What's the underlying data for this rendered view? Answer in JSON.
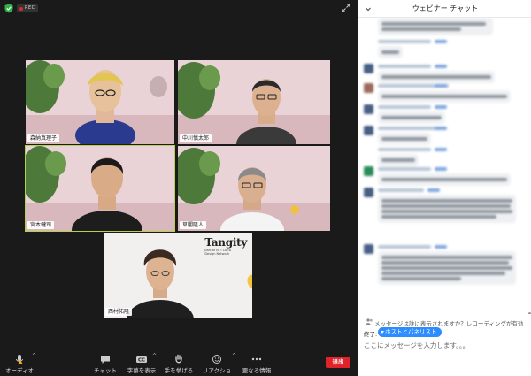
{
  "meeting": {
    "rec_label": "REC",
    "end_label": "退出"
  },
  "participants": [
    {
      "name": "森納真理子"
    },
    {
      "name": "中川慎太郎"
    },
    {
      "name": "宮本健司"
    },
    {
      "name": "草闇隆人"
    },
    {
      "name": "西村祐隆"
    }
  ],
  "shared_logo": {
    "brand": "Tangity",
    "sub1": "part of NTT DATA",
    "sub2": "Design Network"
  },
  "toolbar": {
    "audio_label": "オーディオ",
    "chat_label": "チャット",
    "captions_label": "字幕を表示",
    "raise_hand_label": "手を挙げる",
    "reactions_label": "リアクション",
    "more_label": "更なる情報",
    "cc_badge": "CC"
  },
  "chat": {
    "title": "ウェビナー チャット",
    "visibility_note": "メッセージは誰に表示されますか？レコーディングが有効",
    "to_label": "終了:",
    "recipient": "ホストとパネリスト",
    "input_placeholder": "ここにメッセージを入力します。。。"
  },
  "colors": {
    "accent": "#2d8cff",
    "end_red": "#e0232a",
    "active_speaker": "#b7cf4a",
    "rec_dot": "#e02828"
  }
}
